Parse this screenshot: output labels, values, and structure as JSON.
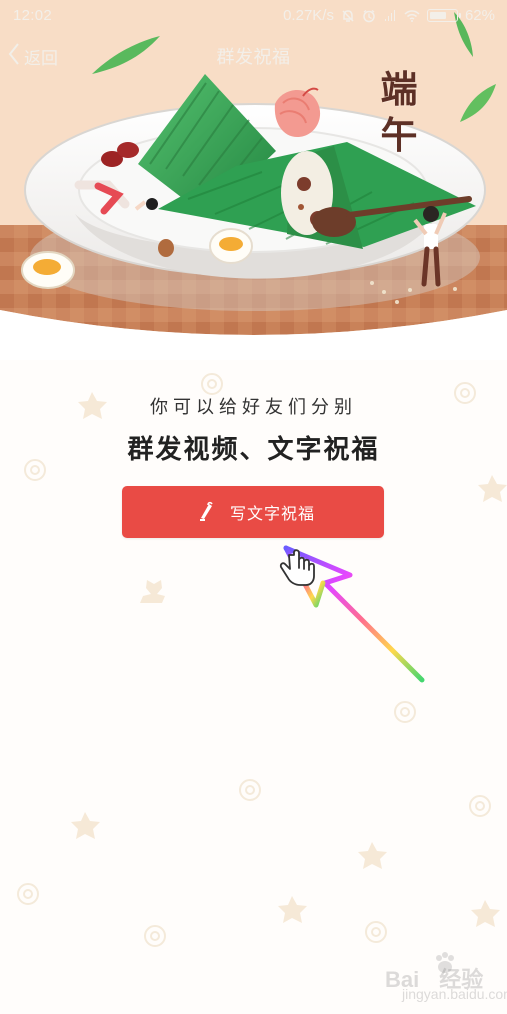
{
  "status_bar": {
    "time": "12:02",
    "network_speed": "0.27K/s",
    "battery_percent": "62%",
    "battery_level": 0.62,
    "icons": [
      "mute-icon",
      "alarm-icon",
      "signal-icon",
      "wifi-icon",
      "battery-icon"
    ]
  },
  "nav": {
    "back_label": "返回",
    "title": "群发祝福"
  },
  "illustration": {
    "festival_text": "端午",
    "description_icons": [
      "zongzi-icon",
      "egg-icon",
      "shrimp-icon",
      "person-icon"
    ]
  },
  "content": {
    "intro": "你可以给好友们分别",
    "headline": "群发视频、文字祝福",
    "button_label": "写文字祝福"
  },
  "watermark": {
    "main": "Bai",
    "main_suffix": "经验",
    "sub": "jingyan.baidu.com"
  },
  "colors": {
    "hero_background": "#f8ddc6",
    "tablecloth": "#c7825a",
    "accent_red": "#e94b45",
    "zongzi_green": "#2f9a4d",
    "text_dark": "#222222"
  }
}
